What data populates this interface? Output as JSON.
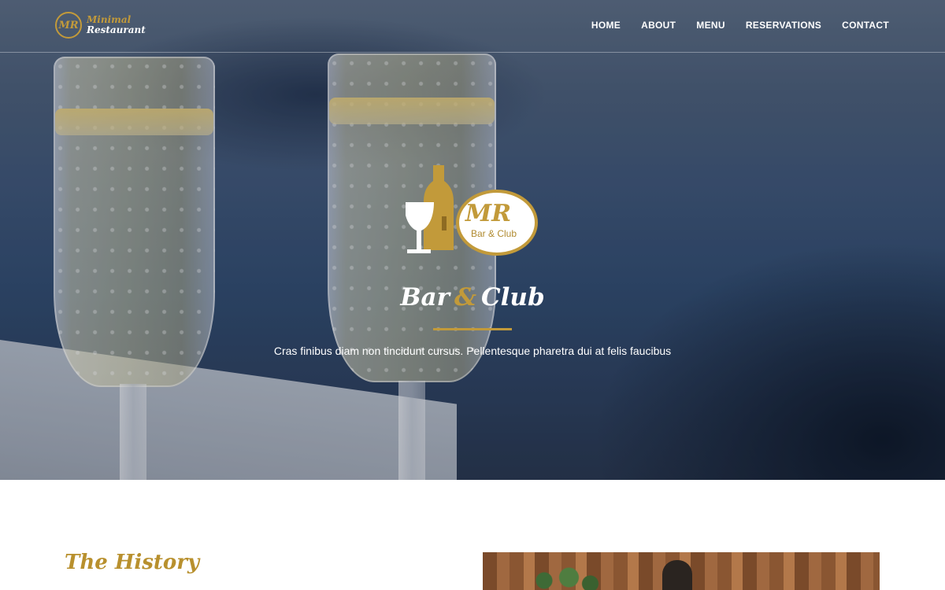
{
  "brand": {
    "mark": "MR",
    "line1": "Minimal",
    "line2": "Restaurant"
  },
  "nav": {
    "items": [
      {
        "label": "HOME"
      },
      {
        "label": "ABOUT"
      },
      {
        "label": "MENU"
      },
      {
        "label": "RESERVATIONS"
      },
      {
        "label": "CONTACT"
      }
    ]
  },
  "hero": {
    "logo": {
      "monogram": "MR",
      "subtitle": "Bar & Club"
    },
    "title": {
      "part1": "Bar",
      "amp": "&",
      "part2": "Club"
    },
    "tagline": "Cras finibus diam non tincidunt cursus. Pellentesque pharetra dui at felis faucibus"
  },
  "history": {
    "heading": "The History"
  },
  "colors": {
    "accent": "#c29a3a",
    "heading": "#b8902e",
    "text_light": "#ffffff"
  },
  "icons": {
    "brand": "restaurant-monogram-icon",
    "hero_logo": "wine-glass-bottle-logo-icon"
  }
}
